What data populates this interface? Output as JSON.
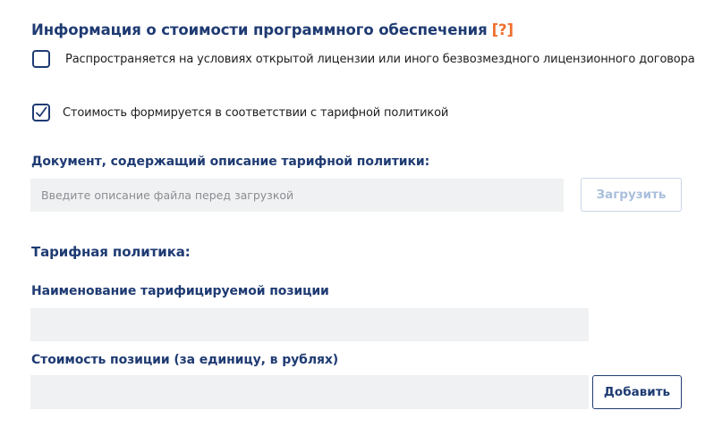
{
  "section": {
    "title": "Информация о стоимости программного обеспечения",
    "help_label": "[?]"
  },
  "checkboxes": [
    {
      "label": "Распространяется на условиях открытой лицензии или иного безвозмездного лицензионного договора",
      "checked": false
    },
    {
      "label": "Стоимость формируется в соответствии с тарифной политикой",
      "checked": true
    }
  ],
  "document": {
    "label": "Документ, содержащий описание тарифной политики:",
    "placeholder": "Введите описание файла перед загрузкой",
    "upload_label": "Загрузить"
  },
  "tariff": {
    "heading": "Тарифная политика:",
    "name_label": "Наименование тарифицируемой позиции",
    "name_value": "",
    "price_label": "Стоимость позиции (за единицу, в рублях)",
    "price_value": "",
    "add_label": "Добавить"
  },
  "colors": {
    "primary": "#1f3b73",
    "help": "#ef6f2e",
    "input_bg": "#f0f1f2",
    "disabled_button": "#a9bfdc"
  },
  "icons": {
    "checkmark": "checkmark-icon"
  }
}
